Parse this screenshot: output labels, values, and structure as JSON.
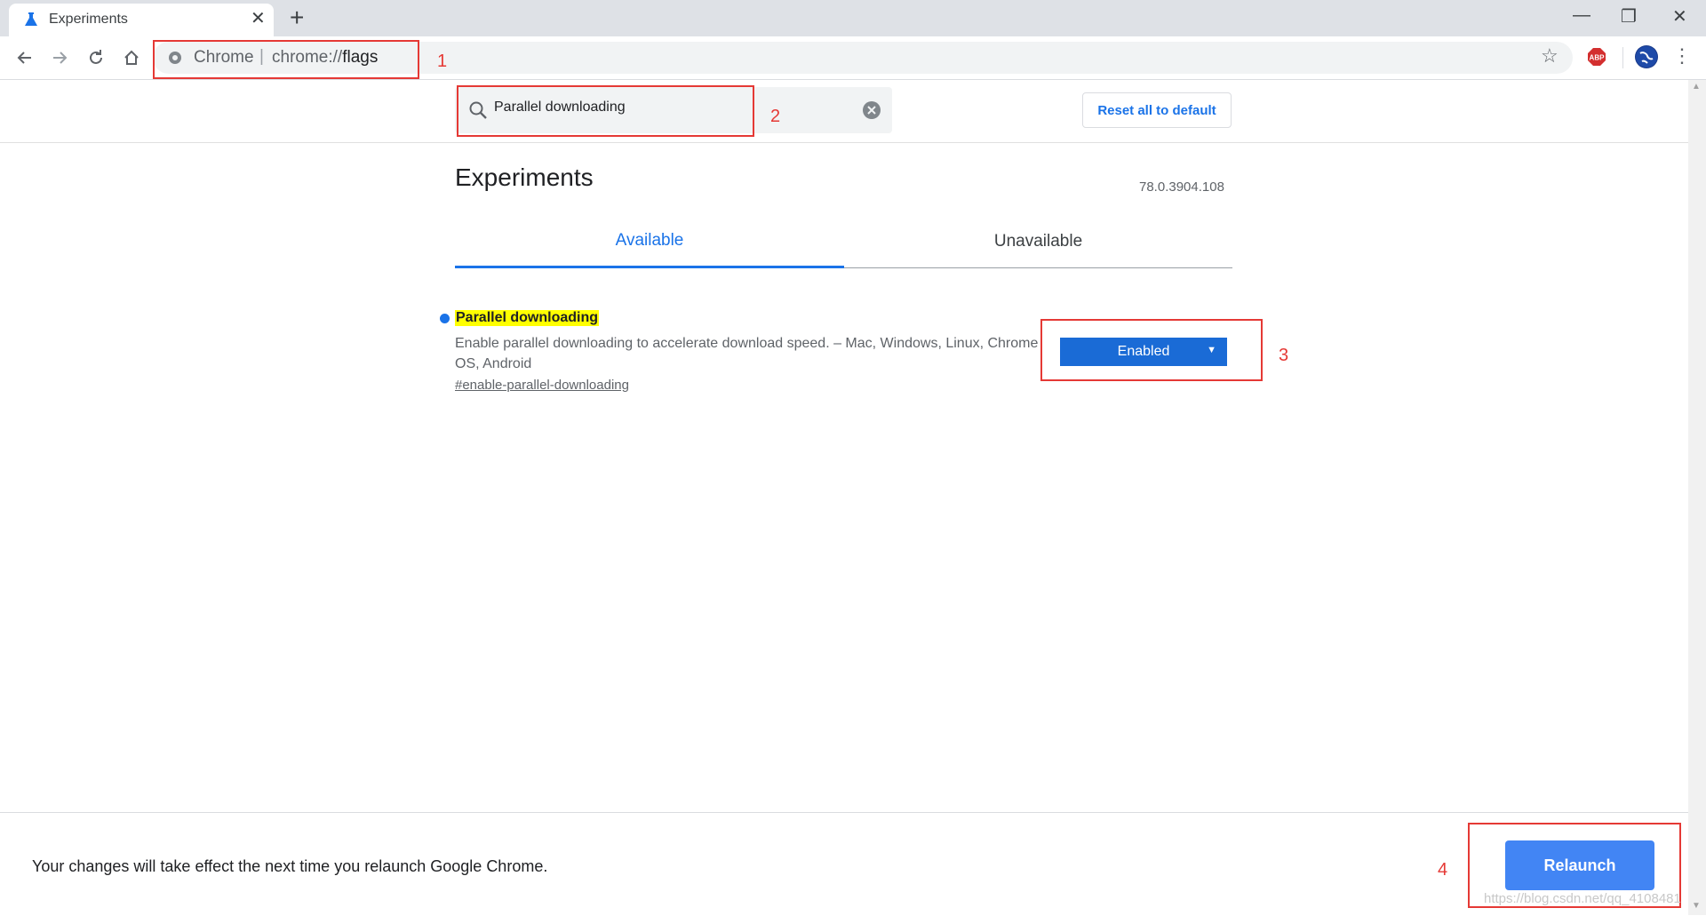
{
  "window": {
    "tab_title": "Experiments",
    "new_tab_symbol": "+",
    "tab_close_symbol": "✕",
    "minimize_symbol": "—",
    "restore_symbol": "❐",
    "close_symbol": "✕"
  },
  "toolbar": {
    "omnibox_site": "Chrome",
    "omnibox_separator": "|",
    "omnibox_scheme": "chrome://",
    "omnibox_path": "flags",
    "abp_label": "ABP"
  },
  "search": {
    "value": "Parallel downloading",
    "reset_label": "Reset all to default"
  },
  "page": {
    "title": "Experiments",
    "version": "78.0.3904.108",
    "tabs": [
      {
        "label": "Available",
        "selected": true
      },
      {
        "label": "Unavailable",
        "selected": false
      }
    ]
  },
  "flag": {
    "name": "Parallel downloading",
    "description": "Enable parallel downloading to accelerate download speed. – Mac, Windows, Linux, Chrome OS, Android",
    "link": "#enable-parallel-downloading",
    "selected_option": "Enabled"
  },
  "bottom": {
    "message": "Your changes will take effect the next time you relaunch Google Chrome.",
    "relaunch_label": "Relaunch",
    "watermark": "https://blog.csdn.net/qq_4108481"
  },
  "annotations": {
    "n1": "1",
    "n2": "2",
    "n3": "3",
    "n4": "4"
  },
  "colors": {
    "accent": "#1a73e8",
    "highlight": "#ffff00",
    "annotation_red": "#e53935",
    "relaunch_button": "#4285f4"
  }
}
